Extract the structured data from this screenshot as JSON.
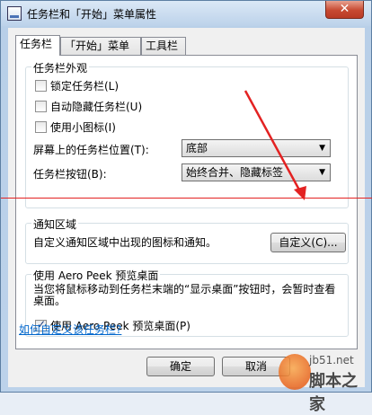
{
  "window": {
    "title": "任务栏和「开始」菜单属性",
    "close_glyph": "✕"
  },
  "tabs": [
    {
      "label": "任务栏",
      "active": true
    },
    {
      "label": "「开始」菜单",
      "active": false
    },
    {
      "label": "工具栏",
      "active": false
    }
  ],
  "appearance": {
    "group_title": "任务栏外观",
    "checkboxes": [
      {
        "label": "锁定任务栏(L)",
        "checked": false
      },
      {
        "label": "自动隐藏任务栏(U)",
        "checked": false
      },
      {
        "label": "使用小图标(I)",
        "checked": false
      }
    ],
    "position_label": "屏幕上的任务栏位置(T):",
    "position_value": "底部",
    "buttons_label": "任务栏按钮(B):",
    "buttons_value": "始终合并、隐藏标签"
  },
  "notify": {
    "group_title": "通知区域",
    "desc": "自定义通知区域中出现的图标和通知。",
    "customize_button": "自定义(C)..."
  },
  "aero": {
    "group_title": "使用 Aero Peek 预览桌面",
    "desc": "当您将鼠标移动到任务栏末端的“显示桌面”按钮时，会暂时查看桌面。",
    "checkbox_label": "使用 Aero Peek 预览桌面(P)",
    "checkbox_checked": true
  },
  "help_link": "如何自定义该任务栏?",
  "footer": {
    "ok": "确定",
    "cancel": "取消"
  },
  "watermark": {
    "site": "jb51.net",
    "name": "脚本之家"
  },
  "colors": {
    "annotation": "#e32222",
    "link": "#0066cc"
  }
}
